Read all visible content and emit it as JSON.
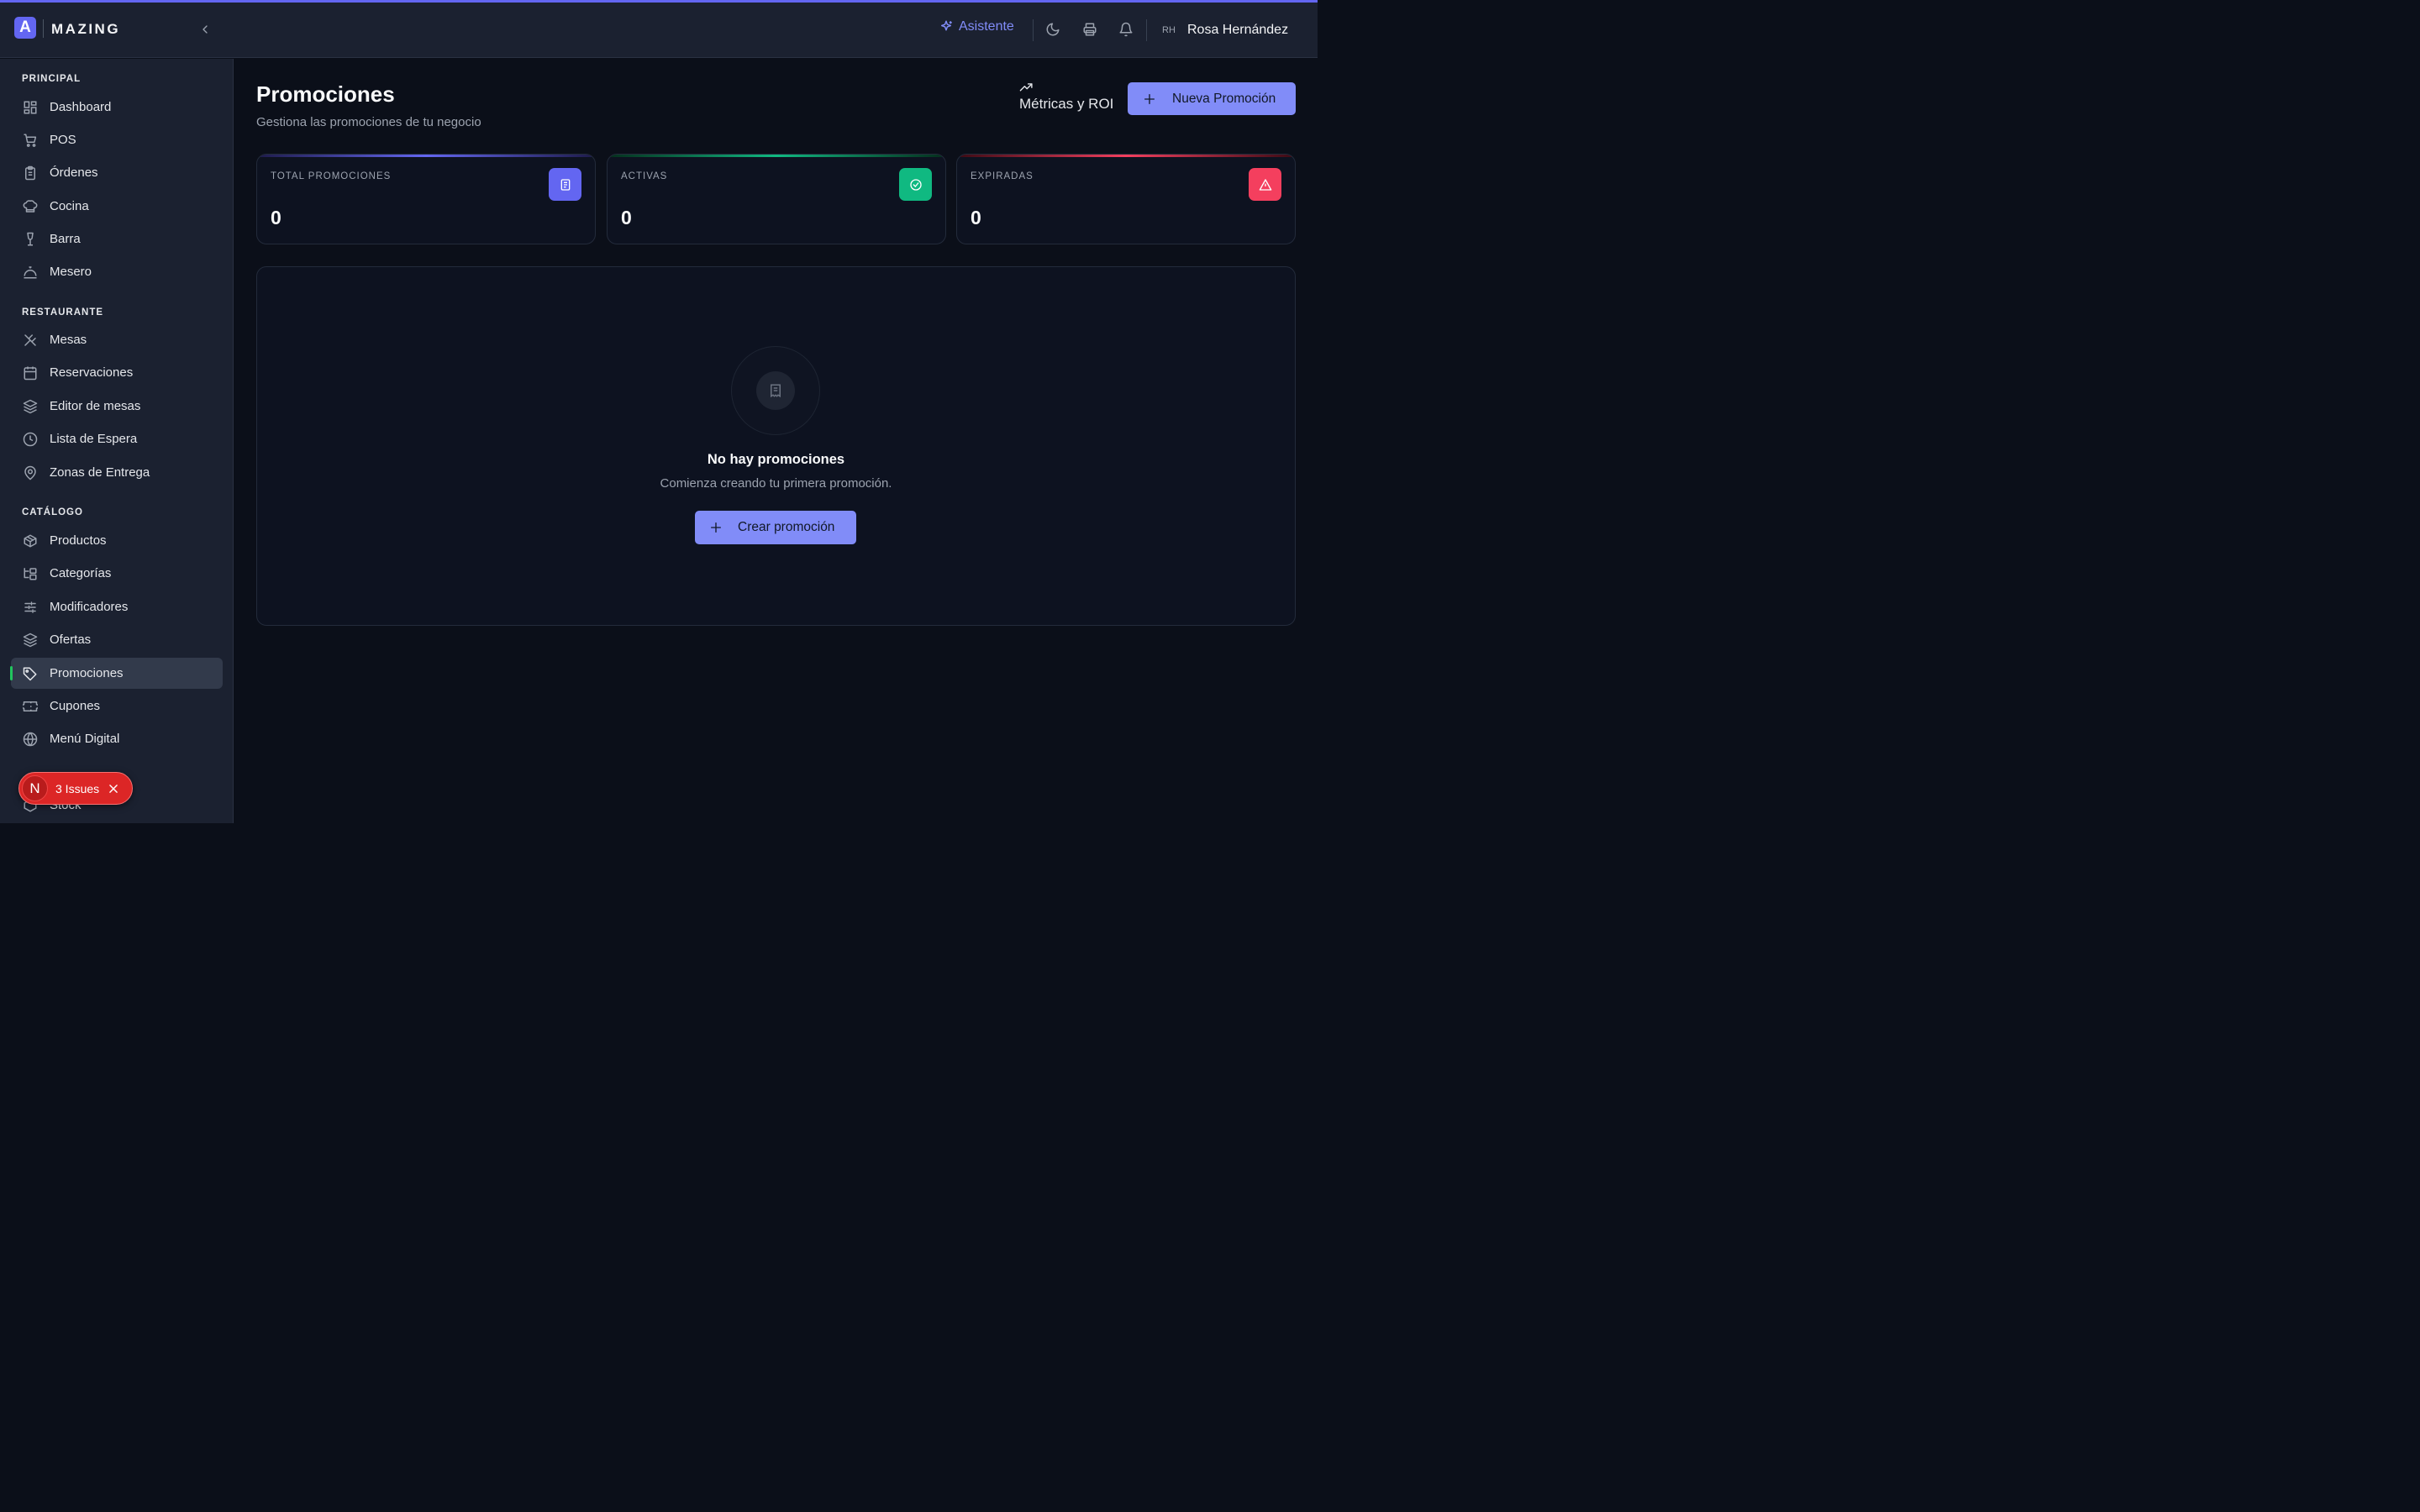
{
  "app": {
    "logo_letter": "A",
    "logo_text": "MAZING"
  },
  "header": {
    "assistant_label": "Asistente",
    "user_initials": "RH",
    "user_name": "Rosa Hernández"
  },
  "sidebar": {
    "sections": [
      {
        "title": "PRINCIPAL",
        "items": [
          "Dashboard",
          "POS",
          "Órdenes",
          "Cocina",
          "Barra",
          "Mesero"
        ]
      },
      {
        "title": "RESTAURANTE",
        "items": [
          "Mesas",
          "Reservaciones",
          "Editor de mesas",
          "Lista de Espera",
          "Zonas de Entrega"
        ]
      },
      {
        "title": "CATÁLOGO",
        "items": [
          "Productos",
          "Categorías",
          "Modificadores",
          "Ofertas",
          "Promociones",
          "Cupones",
          "Menú Digital"
        ]
      }
    ],
    "partial_item": "Stock",
    "active_item": "Promociones"
  },
  "page": {
    "title": "Promociones",
    "subtitle": "Gestiona las promociones de tu negocio",
    "metrics_label": "Métricas y ROI",
    "new_button_label": "Nueva Promoción"
  },
  "stats": [
    {
      "label": "TOTAL PROMOCIONES",
      "value": "0",
      "color": "#6366f1"
    },
    {
      "label": "ACTIVAS",
      "value": "0",
      "color": "#10b981"
    },
    {
      "label": "EXPIRADAS",
      "value": "0",
      "color": "#f43f5e"
    }
  ],
  "empty_state": {
    "title": "No hay promociones",
    "subtitle": "Comienza creando tu primera promoción.",
    "button_label": "Crear promoción"
  },
  "issues_badge": {
    "letter": "N",
    "label": "3 Issues"
  },
  "colors": {
    "accent": "#818cf8",
    "background": "#0b0f19",
    "sidebar": "#1b2130",
    "active_indicator": "#22c55e"
  }
}
